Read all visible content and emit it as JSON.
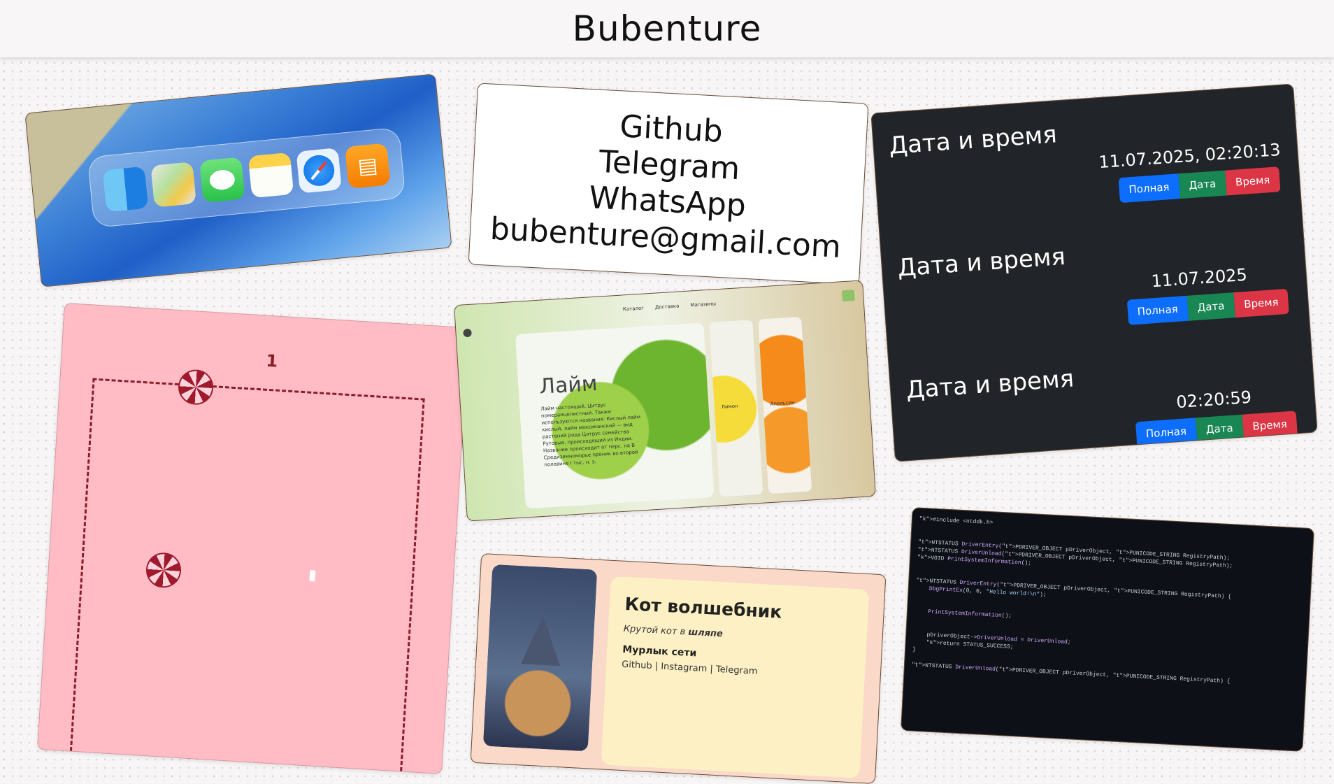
{
  "header": {
    "title": "Bubenture"
  },
  "dock_card": {
    "apps": [
      "finder-icon",
      "maps-icon",
      "messages-icon",
      "notes-icon",
      "safari-icon",
      "books-icon"
    ]
  },
  "contacts": {
    "github": "Github",
    "telegram": "Telegram",
    "whatsapp": "WhatsApp",
    "email": "bubenture@gmail.com"
  },
  "datetime": {
    "blocks": [
      {
        "title": "Дата и время",
        "value": "11.07.2025, 02:20:13"
      },
      {
        "title": "Дата и время",
        "value": "11.07.2025"
      },
      {
        "title": "Дата и время",
        "value": "02:20:59"
      }
    ],
    "buttons": {
      "full": "Полная",
      "date": "Дата",
      "time": "Время"
    },
    "colors": {
      "full": "#0d6efd",
      "date": "#198754",
      "time": "#dc3545"
    }
  },
  "game": {
    "score": "1"
  },
  "lime": {
    "nav": [
      "Каталог",
      "Доставка",
      "Магазины"
    ],
    "title": "Лайм",
    "text": "Лайм настоящий, Цитрус померанцелистный. Также используются названия: Кислый лайм кислый, лайм мексиканский — вид растений рода Цитрус семейства Рутовые, происходящий из Индии. Название происходит от перс. на В Средиземноморье проник во второй половине I тыс. н. э.",
    "lemon_label": "Лимон",
    "orange_label": "Апельсин"
  },
  "cat": {
    "title": "Кот волшебник",
    "subtitle_prefix": "Крутой кот в ",
    "subtitle_bold": "шляпе",
    "section": "Мурлык сети",
    "links": "Github | Instagram | Telegram"
  },
  "code": {
    "lines": [
      "#include <ntddk.h>",
      "",
      "",
      "NTSTATUS DriverEntry(PDRIVER_OBJECT pDriverObject, PUNICODE_STRING RegistryPath);",
      "NTSTATUS DriverUnload(PDRIVER_OBJECT pDriverObject, PUNICODE_STRING RegistryPath);",
      "VOID PrintSystemInformation();",
      "",
      "",
      "NTSTATUS DriverEntry(PDRIVER_OBJECT pDriverObject, PUNICODE_STRING RegistryPath) {",
      "    DbgPrintEx(0, 0, \"Hello world!\\n\");",
      "",
      "",
      "    PrintSystemInformation();",
      "",
      "",
      "    pDriverObject->DriverUnload = DriverUnload;",
      "    return STATUS_SUCCESS;",
      "}",
      "",
      "NTSTATUS DriverUnload(PDRIVER_OBJECT pDriverObject, PUNICODE_STRING RegistryPath) {"
    ]
  }
}
